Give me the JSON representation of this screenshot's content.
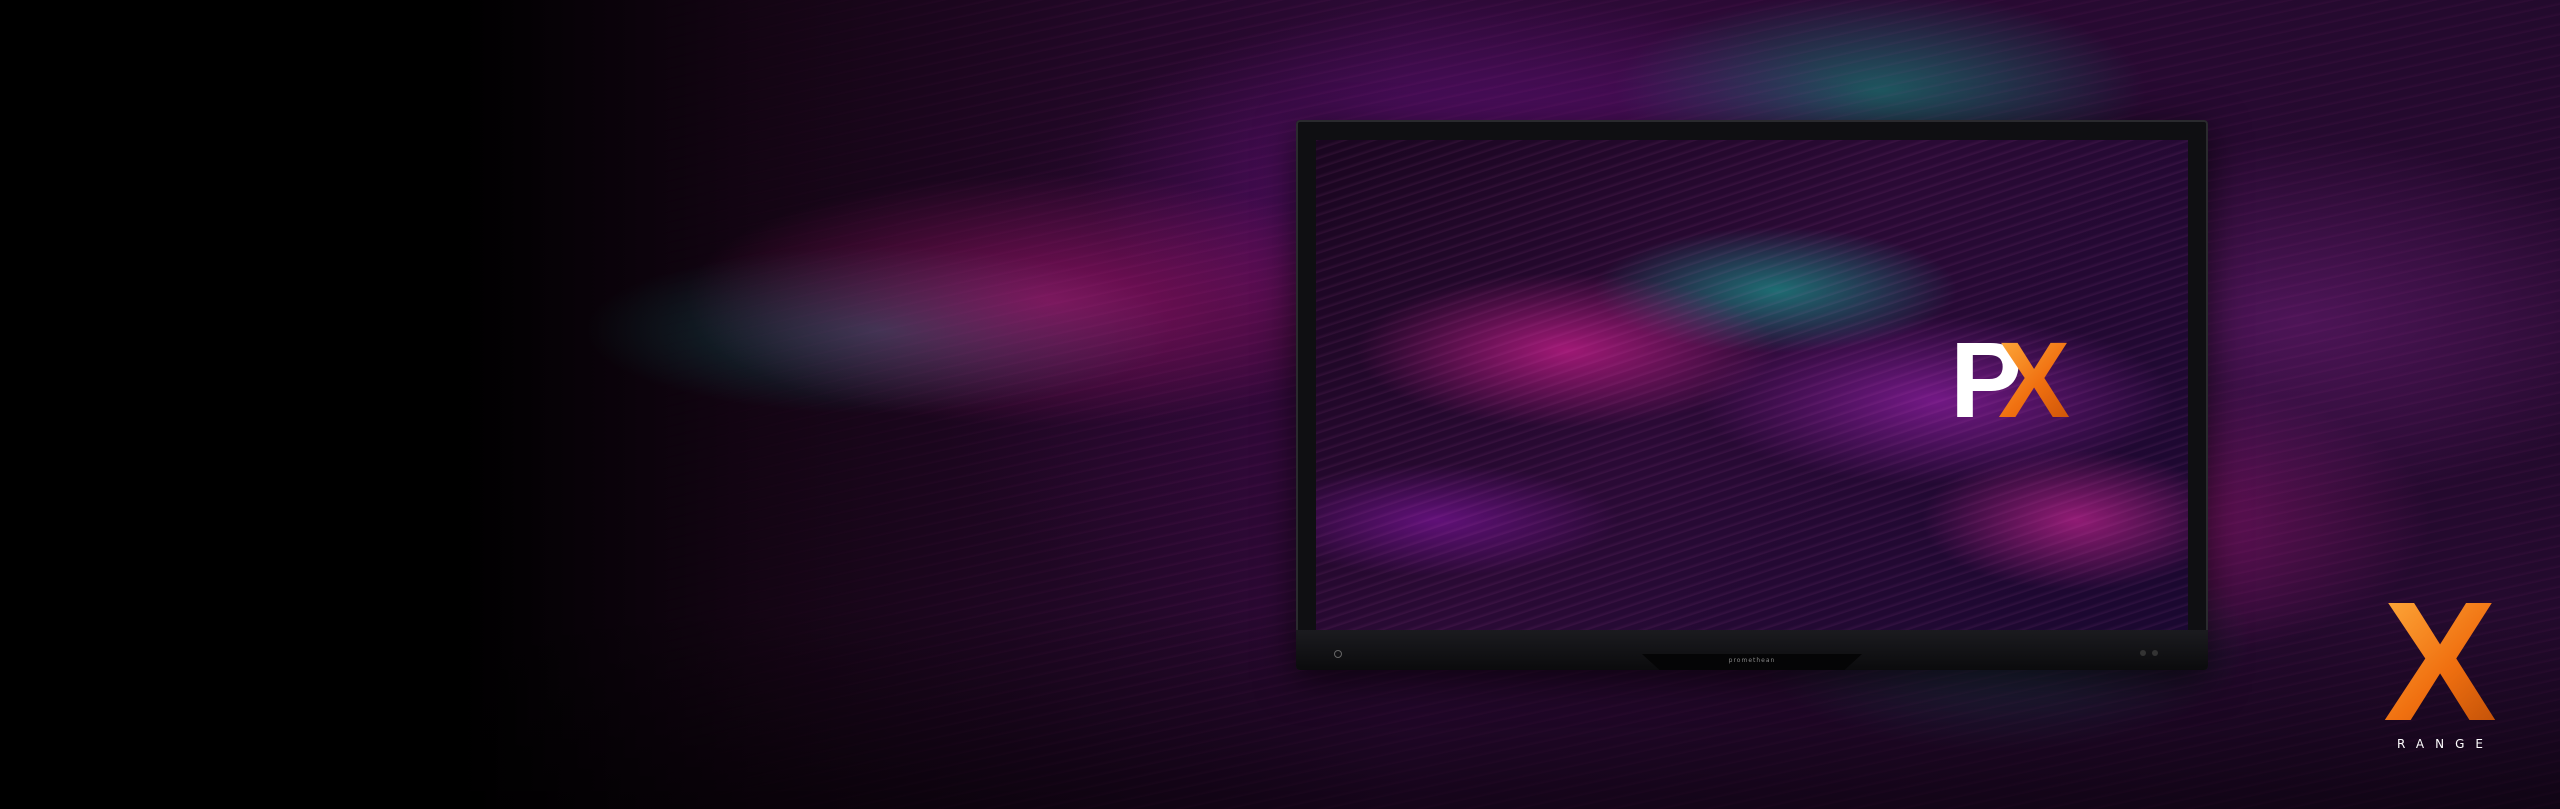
{
  "hero": {
    "display": {
      "bezel_brand": "promethean"
    },
    "px_logo": {
      "letter_p": "P",
      "letter_x": "X"
    },
    "x_range_badge": {
      "letter": "X",
      "label": "RANGE"
    }
  },
  "colors": {
    "background": "#000000",
    "accent_orange": "#f07010",
    "accent_magenta": "#c41880",
    "accent_teal": "#14827a",
    "accent_purple": "#781496",
    "logo_white": "#ffffff"
  }
}
